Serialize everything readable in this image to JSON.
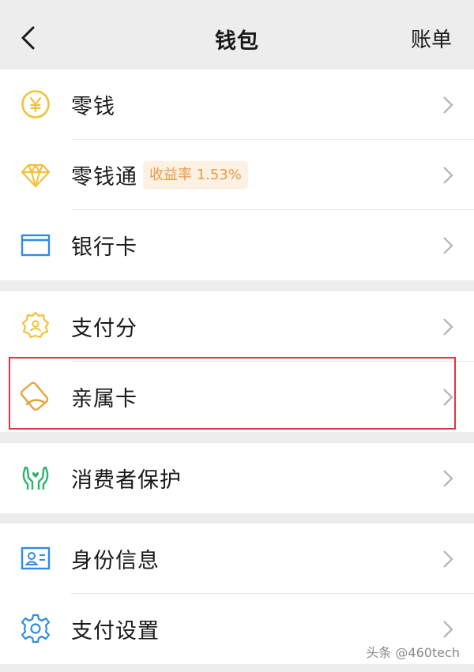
{
  "nav": {
    "title": "钱包",
    "right_label": "账单"
  },
  "groups": [
    {
      "items": [
        {
          "label": "零钱",
          "icon": "yuan-coin-icon",
          "color": "#f2c13a"
        },
        {
          "label": "零钱通",
          "icon": "diamond-icon",
          "color": "#f2c13a",
          "badge": "收益率 1.53%"
        },
        {
          "label": "银行卡",
          "icon": "bank-card-icon",
          "color": "#2f8ce8"
        }
      ]
    },
    {
      "items": [
        {
          "label": "支付分",
          "icon": "score-badge-icon",
          "color": "#f2c13a"
        },
        {
          "label": "亲属卡",
          "icon": "family-card-icon",
          "color": "#e8a23c"
        }
      ]
    },
    {
      "items": [
        {
          "label": "消费者保护",
          "icon": "protection-hands-icon",
          "color": "#2bb36b"
        }
      ]
    },
    {
      "items": [
        {
          "label": "身份信息",
          "icon": "id-card-icon",
          "color": "#2f8ce8"
        },
        {
          "label": "支付设置",
          "icon": "gear-icon",
          "color": "#2f8ce8"
        }
      ]
    }
  ],
  "watermark": "头条 @460tech",
  "colors": {
    "highlight_border": "#e0343f",
    "badge_bg": "#fdf1e4",
    "badge_text": "#ea9b4a"
  }
}
